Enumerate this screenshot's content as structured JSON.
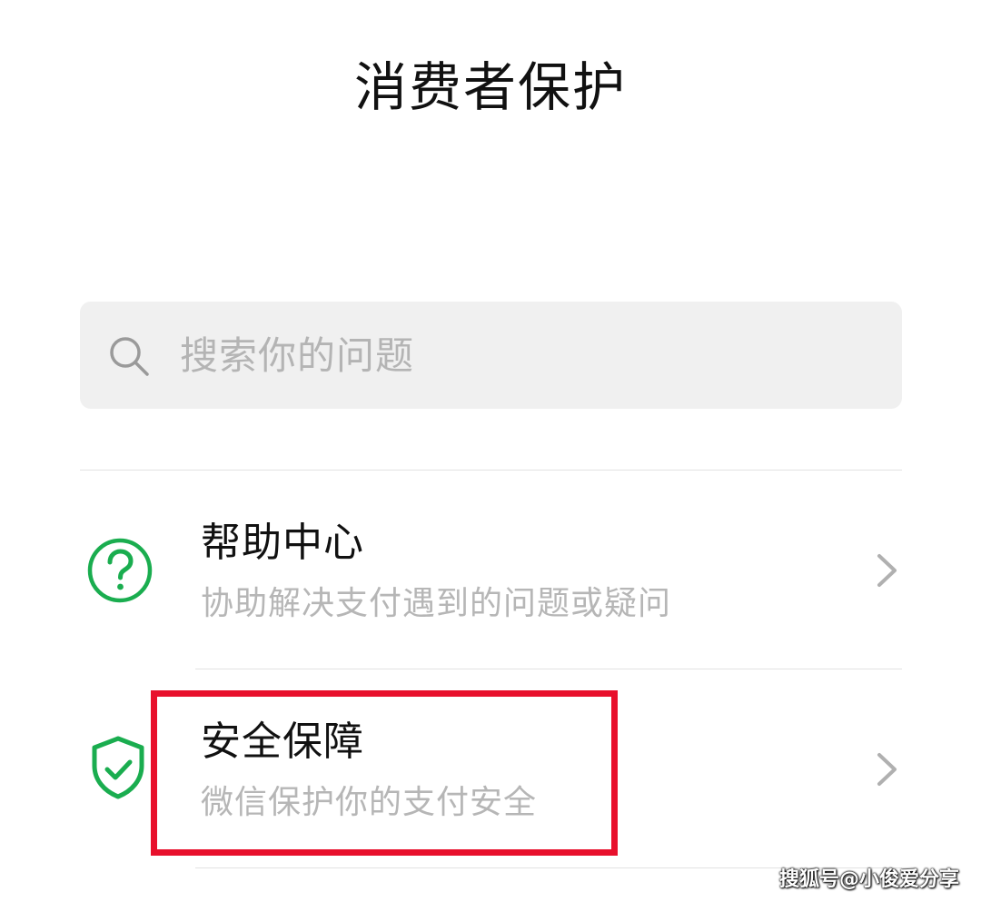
{
  "header": {
    "title": "消费者保护"
  },
  "search": {
    "icon": "search-icon",
    "placeholder": "搜索你的问题"
  },
  "menu": {
    "items": [
      {
        "icon": "help-circle-icon",
        "title": "帮助中心",
        "subtitle": "协助解决支付遇到的问题或疑问"
      },
      {
        "icon": "shield-check-icon",
        "title": "安全保障",
        "subtitle": "微信保护你的支付安全"
      }
    ]
  },
  "annotation": {
    "highlight_color": "#e8102c"
  },
  "colors": {
    "brand_green": "#1aad4f",
    "chevron_gray": "#b0b0b0"
  },
  "watermark": {
    "text": "搜狐号@小俊爱分享"
  }
}
